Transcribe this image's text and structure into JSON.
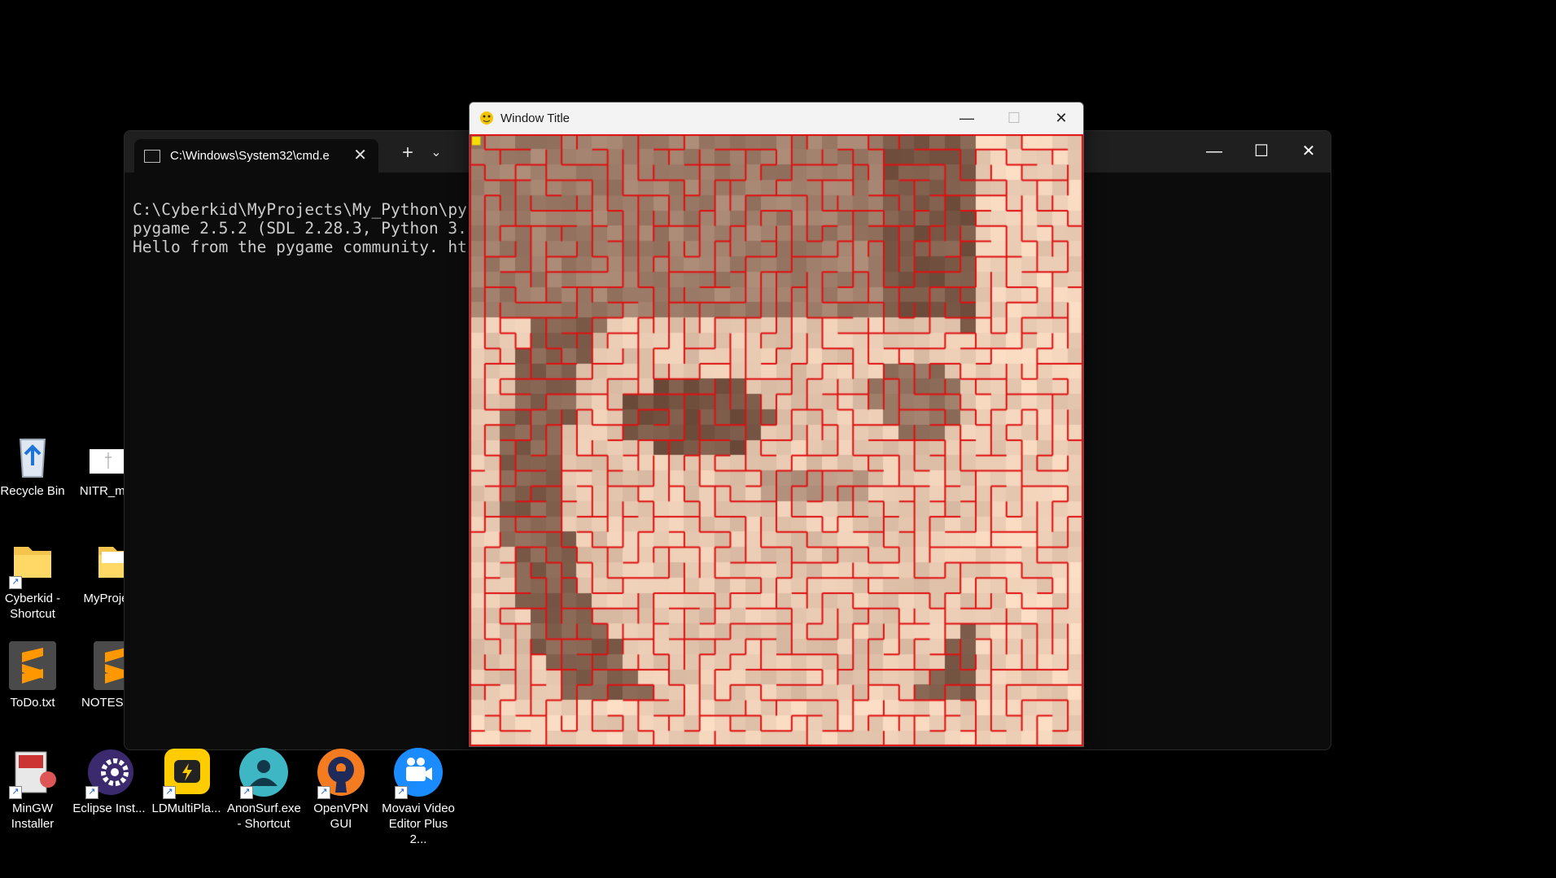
{
  "desktop": {
    "icons": [
      {
        "key": "recycle",
        "label": "Recycle Bin"
      },
      {
        "key": "nitr",
        "label": "NITR_ma"
      },
      {
        "key": "cyberkid",
        "label": "Cyberkid -\nShortcut"
      },
      {
        "key": "myprojects",
        "label": "MyProje"
      },
      {
        "key": "todo",
        "label": "ToDo.txt"
      },
      {
        "key": "notes",
        "label": "NOTES.t"
      },
      {
        "key": "mingw",
        "label": "MinGW\nInstaller"
      },
      {
        "key": "eclipse",
        "label": "Eclipse Inst..."
      },
      {
        "key": "ldmulti",
        "label": "LDMultiPla..."
      },
      {
        "key": "anonsurf",
        "label": "AnonSurf.exe\n- Shortcut"
      },
      {
        "key": "openvpn",
        "label": "OpenVPN\nGUI"
      },
      {
        "key": "movavi",
        "label": "Movavi Video\nEditor Plus 2..."
      }
    ]
  },
  "terminal": {
    "tab_title": "C:\\Windows\\System32\\cmd.e",
    "close_tab": "✕",
    "new_tab": "+",
    "tab_menu": "⌄",
    "minimize": "—",
    "maximize": "☐",
    "close": "✕",
    "lines": [
      "C:\\Cyberkid\\MyProjects\\My_Python\\py",
      "pygame 2.5.2 (SDL 2.28.3, Python 3.",
      "Hello from the pygame community. ht"
    ]
  },
  "pygame_window": {
    "title": "Window Title",
    "minimize": "—",
    "maximize": "☐",
    "close": "✕",
    "maze": {
      "cols": 40,
      "rows": 40,
      "wall_color": "#e01010",
      "start_color": "#f5e000"
    }
  },
  "colors": {
    "desktop_bg": "#000000",
    "terminal_bg": "#0c0c0c",
    "tabbar_bg": "#1f1f1f"
  }
}
